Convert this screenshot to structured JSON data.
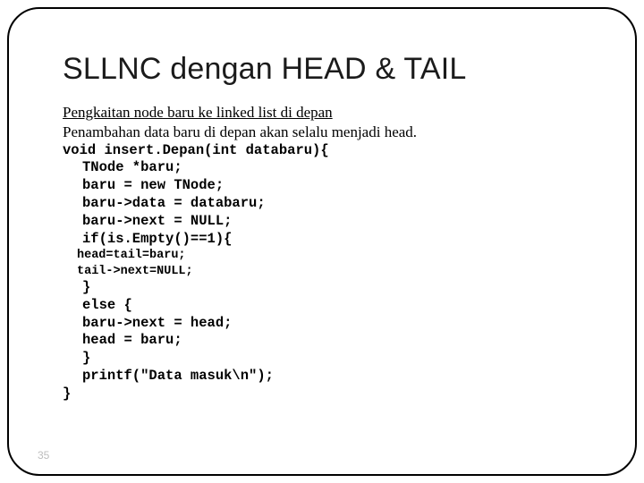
{
  "title": "SLLNC dengan HEAD & TAIL",
  "intro": {
    "line1": "Pengkaitan node baru ke linked list di depan",
    "line2": "Penambahan data baru di depan akan selalu menjadi head."
  },
  "code": {
    "l1": "void insert.Depan(int databaru){",
    "l2": "TNode *baru;",
    "l3": "baru = new TNode;",
    "l4": "baru->data = databaru;",
    "l5": "baru->next = NULL;",
    "l6": "if(is.Empty()==1){",
    "l7": "head=tail=baru;",
    "l8": "tail->next=NULL;",
    "l9": "}",
    "l10": "else {",
    "l11": "baru->next = head;",
    "l12": "head = baru;",
    "l13": "}",
    "l14": "printf(\"Data masuk\\n\");",
    "l15": "}"
  },
  "page": "35"
}
